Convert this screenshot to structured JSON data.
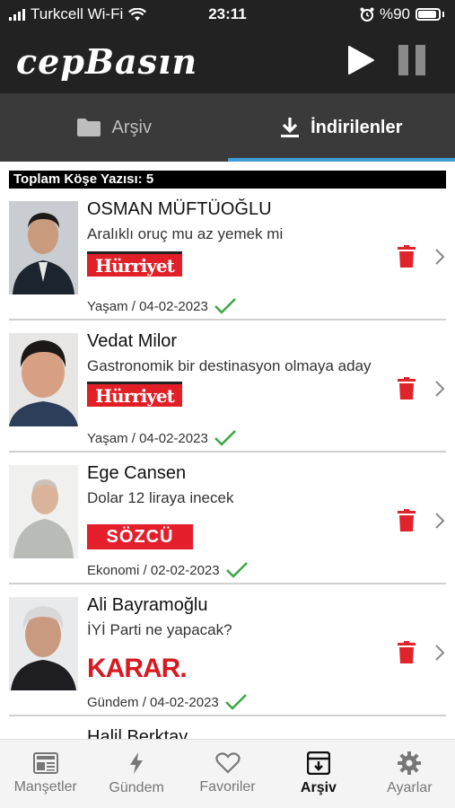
{
  "status_bar": {
    "carrier": "Turkcell Wi-Fi",
    "time": "23:11",
    "battery": "%90"
  },
  "app": {
    "logo_text": "cepBasın"
  },
  "tabs": [
    {
      "label": "Arşiv",
      "icon": "folder-icon",
      "active": false
    },
    {
      "label": "İndirilenler",
      "icon": "download-icon",
      "active": true
    }
  ],
  "summary": {
    "total_label": "Toplam Köşe Yazısı: 5"
  },
  "articles": [
    {
      "author": "OSMAN MÜFTÜOĞLU",
      "title": "Aralıklı oruç mu az yemek mi",
      "publisher": "Hürriyet",
      "meta": "Yaşam / 04-02-2023"
    },
    {
      "author": "Vedat Milor",
      "title": "Gastronomik bir destinasyon olmaya aday",
      "publisher": "Hürriyet",
      "meta": "Yaşam / 04-02-2023"
    },
    {
      "author": "Ege Cansen",
      "title": "Dolar 12 liraya inecek",
      "publisher": "SÖZCÜ",
      "meta": "Ekonomi / 02-02-2023"
    },
    {
      "author": "Ali Bayramoğlu",
      "title": "İYİ Parti ne yapacak?",
      "publisher": "KARAR.",
      "meta": "Gündem / 04-02-2023"
    },
    {
      "author": "Halil Berktay"
    }
  ],
  "bottom_nav": [
    {
      "label": "Manşetler",
      "icon": "newspaper-icon",
      "active": false
    },
    {
      "label": "Gündem",
      "icon": "lightning-icon",
      "active": false
    },
    {
      "label": "Favoriler",
      "icon": "heart-icon",
      "active": false
    },
    {
      "label": "Arşiv",
      "icon": "archive-icon",
      "active": true
    },
    {
      "label": "Ayarlar",
      "icon": "gear-icon",
      "active": false
    }
  ],
  "colors": {
    "accent": "#3f9ad6",
    "delete": "#e0242b",
    "check": "#3aa844",
    "hurriyet": "#e21f26",
    "sozcu": "#e41e2b",
    "karar": "#d71920"
  }
}
